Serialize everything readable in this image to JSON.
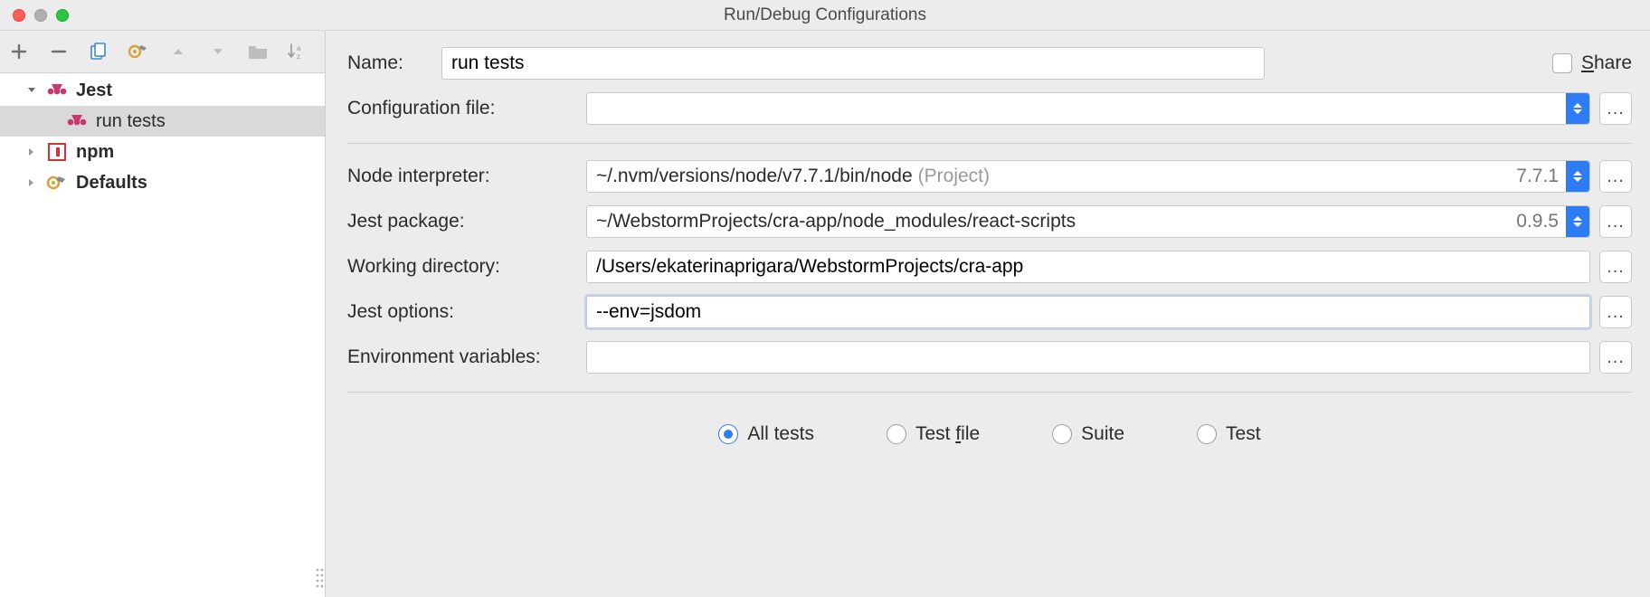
{
  "window": {
    "title": "Run/Debug Configurations"
  },
  "sidebar": {
    "items": [
      {
        "label": "Jest",
        "icon": "jest",
        "bold": true,
        "depth": 1,
        "expandable": true,
        "expanded": true
      },
      {
        "label": "run tests",
        "icon": "jest",
        "bold": false,
        "depth": 2,
        "expandable": false,
        "selected": true
      },
      {
        "label": "npm",
        "icon": "npm",
        "bold": true,
        "depth": 1,
        "expandable": true,
        "expanded": false
      },
      {
        "label": "Defaults",
        "icon": "wrench",
        "bold": true,
        "depth": 1,
        "expandable": true,
        "expanded": false
      }
    ]
  },
  "form": {
    "name_label": "Name:",
    "name_value": "run tests",
    "share_label_pre": "S",
    "share_label_rest": "hare",
    "config_file_label": "Configuration file:",
    "config_file_value": "",
    "node_interp_label": "Node interpreter:",
    "node_interp_value": "~/.nvm/versions/node/v7.7.1/bin/node",
    "node_interp_hint": "(Project)",
    "node_interp_version": "7.7.1",
    "jest_pkg_label": "Jest package:",
    "jest_pkg_value": "~/WebstormProjects/cra-app/node_modules/react-scripts",
    "jest_pkg_version": "0.9.5",
    "work_dir_label": "Working directory:",
    "work_dir_value": "/Users/ekaterinaprigara/WebstormProjects/cra-app",
    "jest_opts_label": "Jest options:",
    "jest_opts_value": "--env=jsdom",
    "env_vars_label": "Environment variables:",
    "env_vars_value": "",
    "scope": {
      "all": "All tests",
      "file_pre": "Test ",
      "file_u": "f",
      "file_rest": "ile",
      "suite": "Suite",
      "test": "Test",
      "selected": "all"
    }
  }
}
